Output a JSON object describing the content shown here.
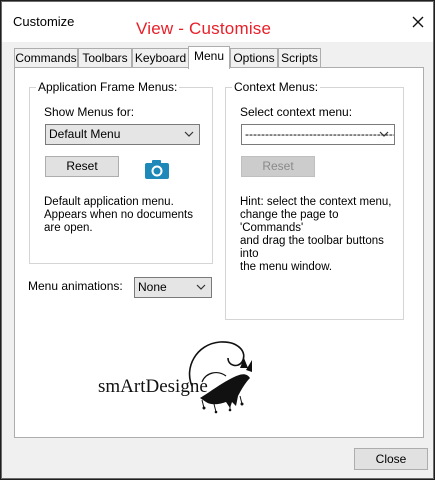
{
  "window": {
    "title": "Customize",
    "overlay_title": "View - Customise"
  },
  "tabs": [
    {
      "label": "Commands"
    },
    {
      "label": "Toolbars"
    },
    {
      "label": "Keyboard"
    },
    {
      "label": "Menu"
    },
    {
      "label": "Options"
    },
    {
      "label": "Scripts"
    }
  ],
  "active_tab": "Menu",
  "app_frame_menus": {
    "group_label": "Application Frame Menus:",
    "show_menus_label": "Show Menus for:",
    "show_menus_value": "Default Menu",
    "reset_label": "Reset",
    "description_lines": [
      "Default application menu.",
      "Appears when no documents",
      "are open."
    ]
  },
  "context_menus": {
    "group_label": "Context Menus:",
    "select_label": "Select context menu:",
    "select_value": "-------------------------------------------",
    "reset_label": "Reset",
    "hint_lines": [
      "Hint: select the context menu,",
      "change the page to 'Commands'",
      "and drag the toolbar buttons into",
      "the menu window."
    ]
  },
  "menu_animations": {
    "label": "Menu animations:",
    "value": "None"
  },
  "logo": {
    "text": "smArtDesigne"
  },
  "footer": {
    "close_label": "Close"
  },
  "colors": {
    "watermark": "#e8202a",
    "camera_icon": "#1e88b8"
  }
}
